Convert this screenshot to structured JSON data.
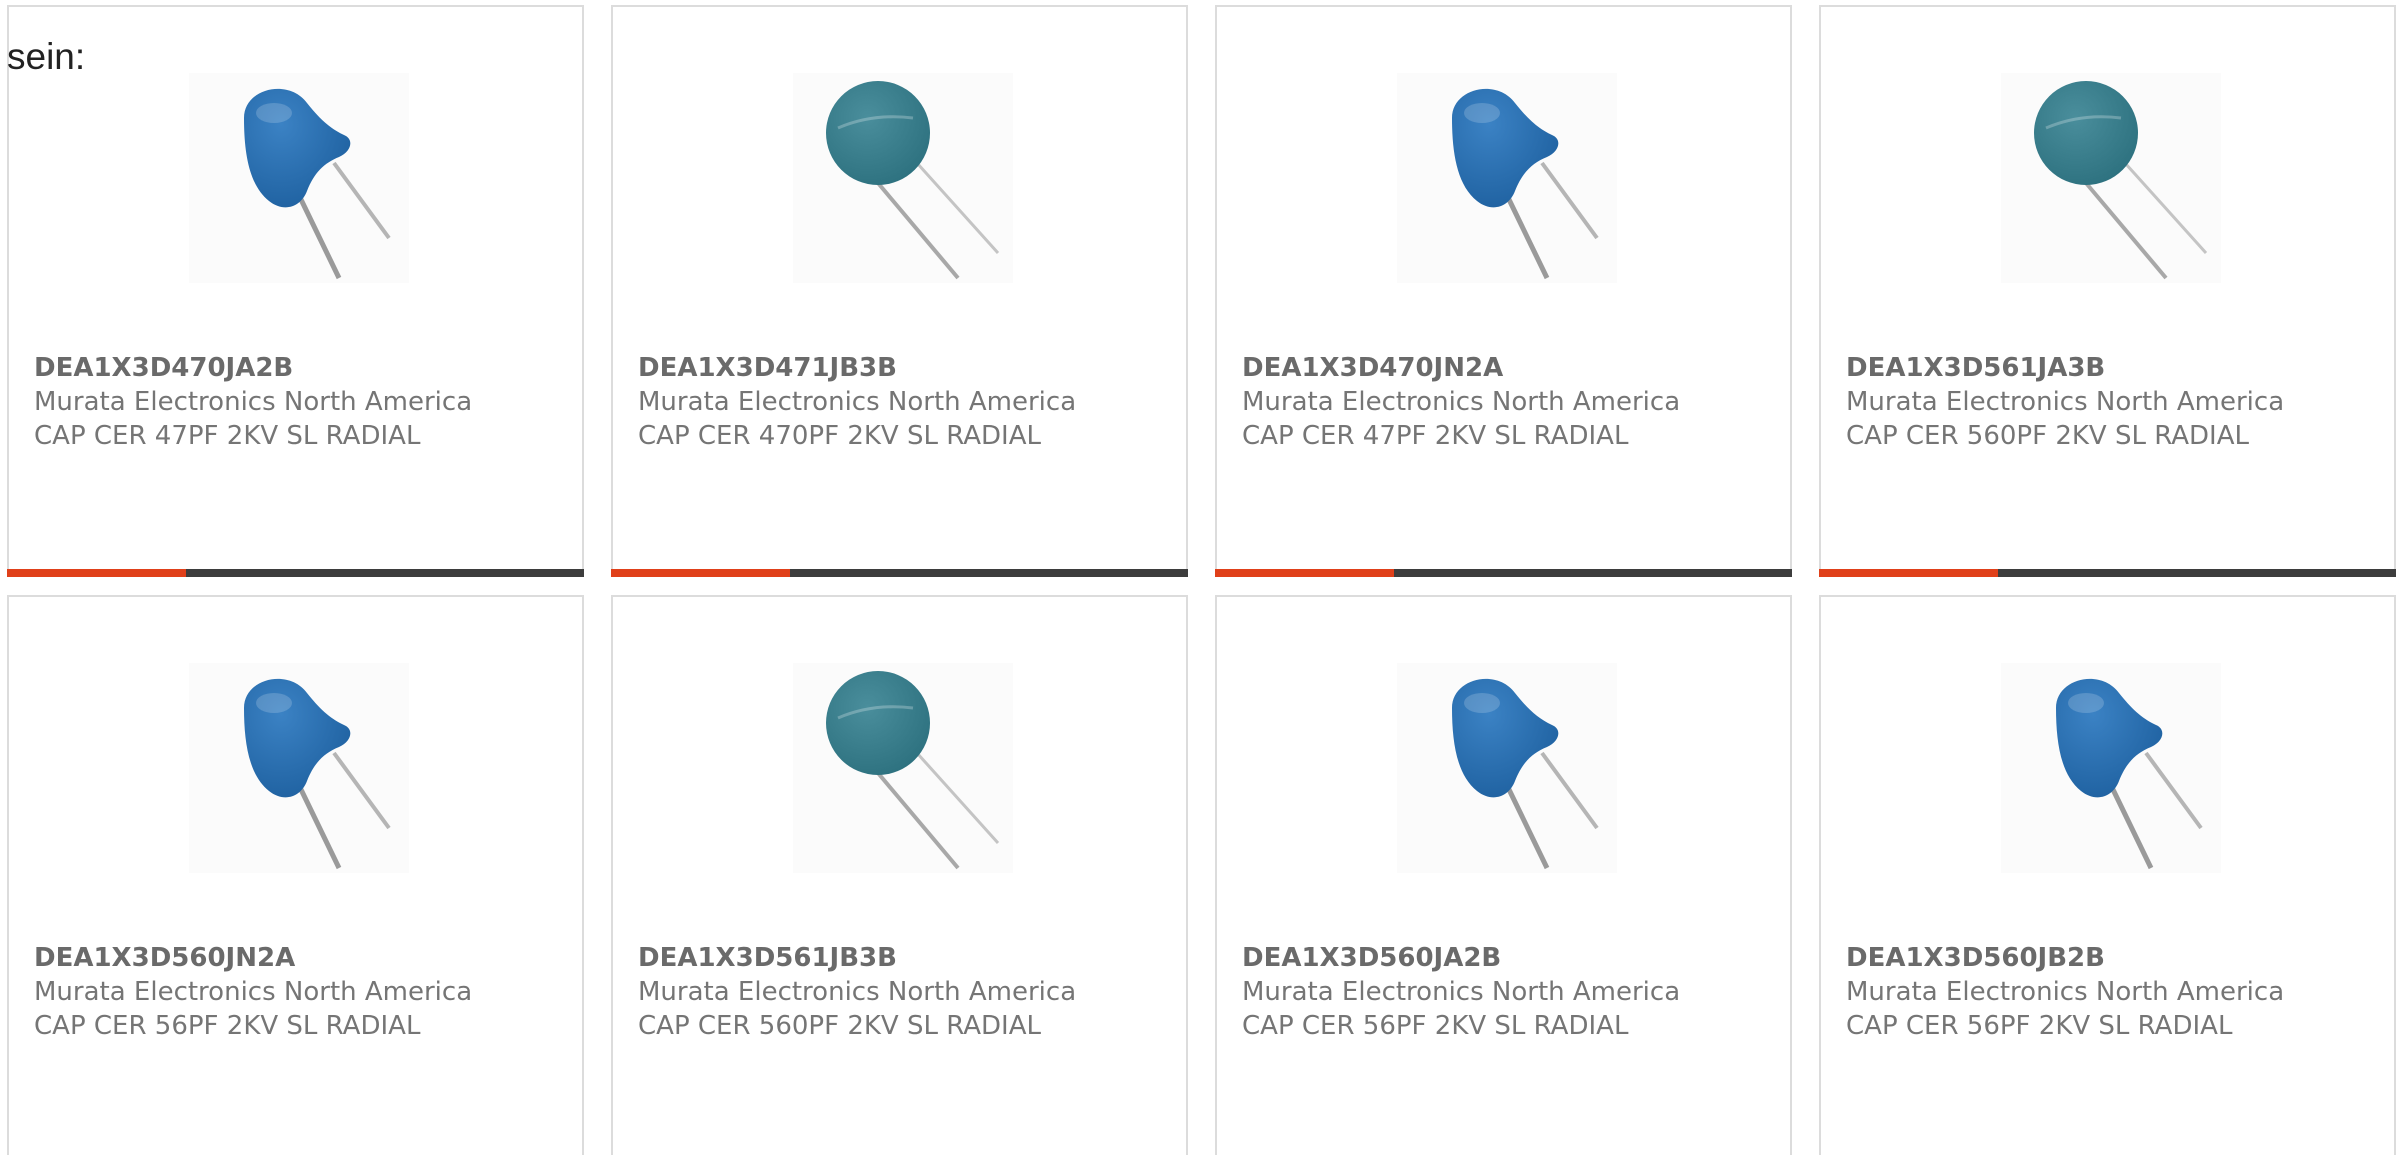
{
  "intro_text": "sein:",
  "colors": {
    "accent": "#e0401a",
    "track": "#3d3d3d",
    "border": "#dcdcdc",
    "text_muted": "#757575",
    "capacitor_blue": "#1d5f9e",
    "capacitor_teal": "#2b6f7d"
  },
  "products": [
    {
      "part_number": "DEA1X3D470JA2B",
      "manufacturer": "Murata Electronics North America",
      "description": "CAP CER 47PF 2KV SL RADIAL",
      "image_icon": "capacitor-blue-icon",
      "progress": 0.31
    },
    {
      "part_number": "DEA1X3D471JB3B",
      "manufacturer": "Murata Electronics North America",
      "description": "CAP CER 470PF 2KV SL RADIAL",
      "image_icon": "capacitor-teal-icon",
      "progress": 0.31
    },
    {
      "part_number": "DEA1X3D470JN2A",
      "manufacturer": "Murata Electronics North America",
      "description": "CAP CER 47PF 2KV SL RADIAL",
      "image_icon": "capacitor-blue-icon",
      "progress": 0.31
    },
    {
      "part_number": "DEA1X3D561JA3B",
      "manufacturer": "Murata Electronics North America",
      "description": "CAP CER 560PF 2KV SL RADIAL",
      "image_icon": "capacitor-teal-icon",
      "progress": 0.31
    },
    {
      "part_number": "DEA1X3D560JN2A",
      "manufacturer": "Murata Electronics North America",
      "description": "CAP CER 56PF 2KV SL RADIAL",
      "image_icon": "capacitor-blue-icon"
    },
    {
      "part_number": "DEA1X3D561JB3B",
      "manufacturer": "Murata Electronics North America",
      "description": "CAP CER 560PF 2KV SL RADIAL",
      "image_icon": "capacitor-teal-icon"
    },
    {
      "part_number": "DEA1X3D560JA2B",
      "manufacturer": "Murata Electronics North America",
      "description": "CAP CER 56PF 2KV SL RADIAL",
      "image_icon": "capacitor-blue-icon"
    },
    {
      "part_number": "DEA1X3D560JB2B",
      "manufacturer": "Murata Electronics North America",
      "description": "CAP CER 56PF 2KV SL RADIAL",
      "image_icon": "capacitor-blue-icon"
    }
  ]
}
